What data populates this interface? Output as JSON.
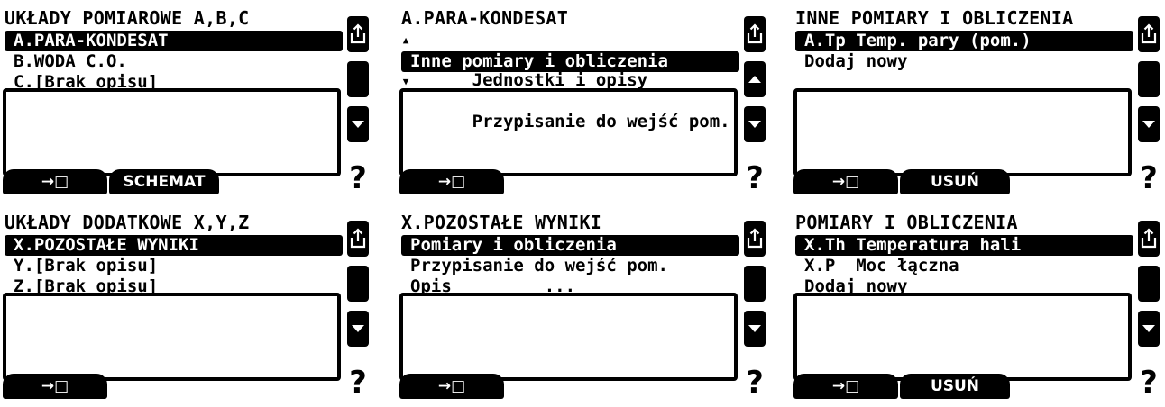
{
  "screens": [
    {
      "title": "UKŁADY POMIAROWE A,B,C",
      "items": [
        "A.PARA-KONDESAT",
        "B.WODA C.O.",
        "C.[Brak opisu]"
      ],
      "selected": 0,
      "buttons": {
        "enter": "→□",
        "second": "SCHEMAT"
      }
    },
    {
      "title": "A.PARA-KONDESAT",
      "items": [
        "Jednostki i opisy",
        "Inne pomiary i obliczenia",
        "Przypisanie do wejść pom."
      ],
      "selected": 1,
      "buttons": {
        "enter": "→□",
        "second": ""
      }
    },
    {
      "title": "INNE POMIARY I OBLICZENIA",
      "items": [
        "A.Tp Temp. pary (pom.)",
        "Dodaj nowy",
        ""
      ],
      "selected": 0,
      "buttons": {
        "enter": "→□",
        "second": "USUŃ"
      }
    },
    {
      "title": "UKŁADY DODATKOWE X,Y,Z",
      "items": [
        "X.POZOSTAŁE WYNIKI",
        "Y.[Brak opisu]",
        "Z.[Brak opisu]"
      ],
      "selected": 0,
      "buttons": {
        "enter": "→□",
        "second": ""
      }
    },
    {
      "title": "X.POZOSTAŁE WYNIKI",
      "items": [
        "Pomiary i obliczenia",
        "Przypisanie do wejść pom.",
        "Opis         ..."
      ],
      "selected": 0,
      "buttons": {
        "enter": "→□",
        "second": ""
      }
    },
    {
      "title": "POMIARY I OBLICZENIA",
      "items": [
        "X.Th Temperatura hali",
        "X.P  Moc łączna",
        "Dodaj nowy"
      ],
      "selected": 0,
      "buttons": {
        "enter": "→□",
        "second": "USUŃ"
      }
    }
  ],
  "help_label": "?",
  "icons": {
    "export": "export-icon",
    "up": "arrow-up-icon",
    "down": "arrow-down-icon"
  }
}
